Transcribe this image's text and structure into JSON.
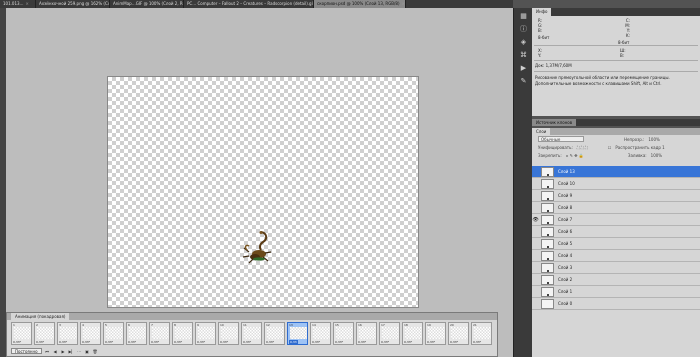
{
  "tabs": [
    {
      "label": "101.013…",
      "active": false
    },
    {
      "label": "Ахэйнхочной 259.png @ 162% (Слой…",
      "active": false
    },
    {
      "label": "AnimMap…GIF @ 100% (Слой 2, RGB/…",
      "active": false
    },
    {
      "label": "PC… Computer – Fallout 2 – Creatures – Radscorpion (detail).gif",
      "active": false
    },
    {
      "label": "скорпион.psd @ 100% (Слой 13, RGB/8)",
      "active": true
    }
  ],
  "info_panel": {
    "tab": "Инфо",
    "left_rgb": [
      "R:",
      "G:",
      "B:"
    ],
    "left_bits": "8-бит",
    "right_cmyk": [
      "C:",
      "M:",
      "Y:",
      "K:"
    ],
    "right_bits": "8-бит",
    "xy": [
      "X:",
      "Y:"
    ],
    "wh": [
      "Ш:",
      "В:"
    ],
    "doc": "Док: 1,37M/7,60M",
    "hint": "Рисование прямоугольной области или перемещение границы. Дополнительные возможности с клавишами Shift, Alt и Ctrl."
  },
  "clone_panel": {
    "tab": "Источник клонов"
  },
  "layers_panel": {
    "tab": "Слои",
    "blend_mode": "Обычные",
    "opacity_label": "Непрозр.:",
    "opacity": "100%",
    "unify_label": "Унифицировать:",
    "propagate_label": "Распространить кадр 1",
    "lock_label": "Закрепить:",
    "fill_label": "Заливка:",
    "fill": "100%",
    "layers": [
      {
        "name": "Слой 13",
        "active": true,
        "visible": false
      },
      {
        "name": "Слой 10",
        "active": false,
        "visible": false
      },
      {
        "name": "Слой 9",
        "active": false,
        "visible": false
      },
      {
        "name": "Слой 8",
        "active": false,
        "visible": false
      },
      {
        "name": "Слой 7",
        "active": false,
        "visible": true
      },
      {
        "name": "Слой 6",
        "active": false,
        "visible": false
      },
      {
        "name": "Слой 5",
        "active": false,
        "visible": false
      },
      {
        "name": "Слой 4",
        "active": false,
        "visible": false
      },
      {
        "name": "Слой 3",
        "active": false,
        "visible": false
      },
      {
        "name": "Слой 2",
        "active": false,
        "visible": false
      },
      {
        "name": "Слой 1",
        "active": false,
        "visible": false
      },
      {
        "name": "Слой 0",
        "active": false,
        "visible": false
      }
    ]
  },
  "animation_panel": {
    "tab": "Анимация (покадровая)",
    "loop": "Постоянно",
    "frames": [
      {
        "num": "1",
        "delay": "0,33*"
      },
      {
        "num": "2",
        "delay": "0,33*"
      },
      {
        "num": "3",
        "delay": "0,33*"
      },
      {
        "num": "4",
        "delay": "0,33*"
      },
      {
        "num": "5",
        "delay": "0,33*"
      },
      {
        "num": "6",
        "delay": "0,33*"
      },
      {
        "num": "7",
        "delay": "0,33*"
      },
      {
        "num": "8",
        "delay": "0,33*"
      },
      {
        "num": "9",
        "delay": "0,33*"
      },
      {
        "num": "10",
        "delay": "0,33*"
      },
      {
        "num": "11",
        "delay": "0,33*"
      },
      {
        "num": "12",
        "delay": "0,33*"
      },
      {
        "num": "13",
        "delay": "0,33",
        "selected": true
      },
      {
        "num": "14",
        "delay": "0,33*"
      },
      {
        "num": "15",
        "delay": "0,33*"
      },
      {
        "num": "16",
        "delay": "0,33*"
      },
      {
        "num": "17",
        "delay": "0,33*"
      },
      {
        "num": "18",
        "delay": "0,33*"
      },
      {
        "num": "19",
        "delay": "0,33*"
      },
      {
        "num": "20",
        "delay": "0,33*"
      },
      {
        "num": "21",
        "delay": "0,33*"
      }
    ],
    "controls": [
      "first-frame-icon",
      "prev-frame-icon",
      "play-icon",
      "next-frame-icon",
      "tween-icon",
      "new-frame-icon",
      "delete-frame-icon"
    ]
  },
  "colors": {
    "accent": "#3875d7",
    "selected_frame": "#2f6ccf"
  }
}
